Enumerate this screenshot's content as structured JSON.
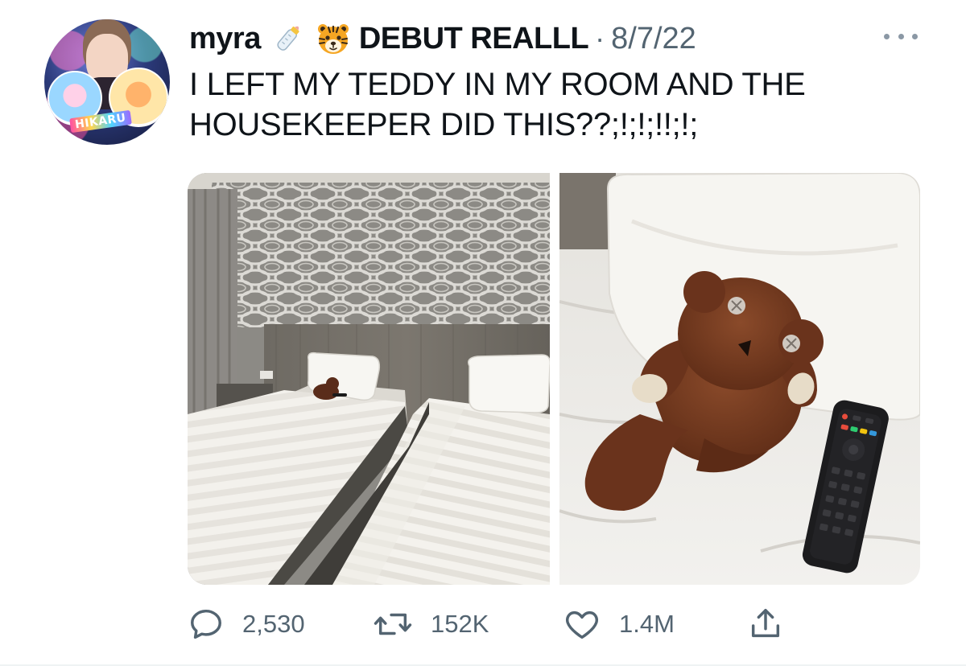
{
  "user": {
    "display_name": "myra",
    "emoji_1": "baby-bottle-emoji",
    "emoji_2": "tiger-face-emoji",
    "display_name_suffix": "DEBUT REALLL",
    "separator": "·",
    "date": "8/7/22",
    "avatar_label": "HIKARU"
  },
  "tweet": {
    "lines": [
      "I LEFT MY TEDDY IN MY ROOM AND THE",
      "HOUSEKEEPER DID THIS??;!;!;!!;!;"
    ]
  },
  "media": {
    "photo_left": "hotel-room-two-beds-photo",
    "photo_right": "teddy-bear-with-tv-remote-photo"
  },
  "actions": {
    "replies": "2,530",
    "retweets": "152K",
    "likes": "1.4M",
    "share_icon": "share-icon"
  },
  "colors": {
    "text_primary": "#0f1419",
    "text_secondary": "#536471",
    "icon_gray": "#536471"
  }
}
